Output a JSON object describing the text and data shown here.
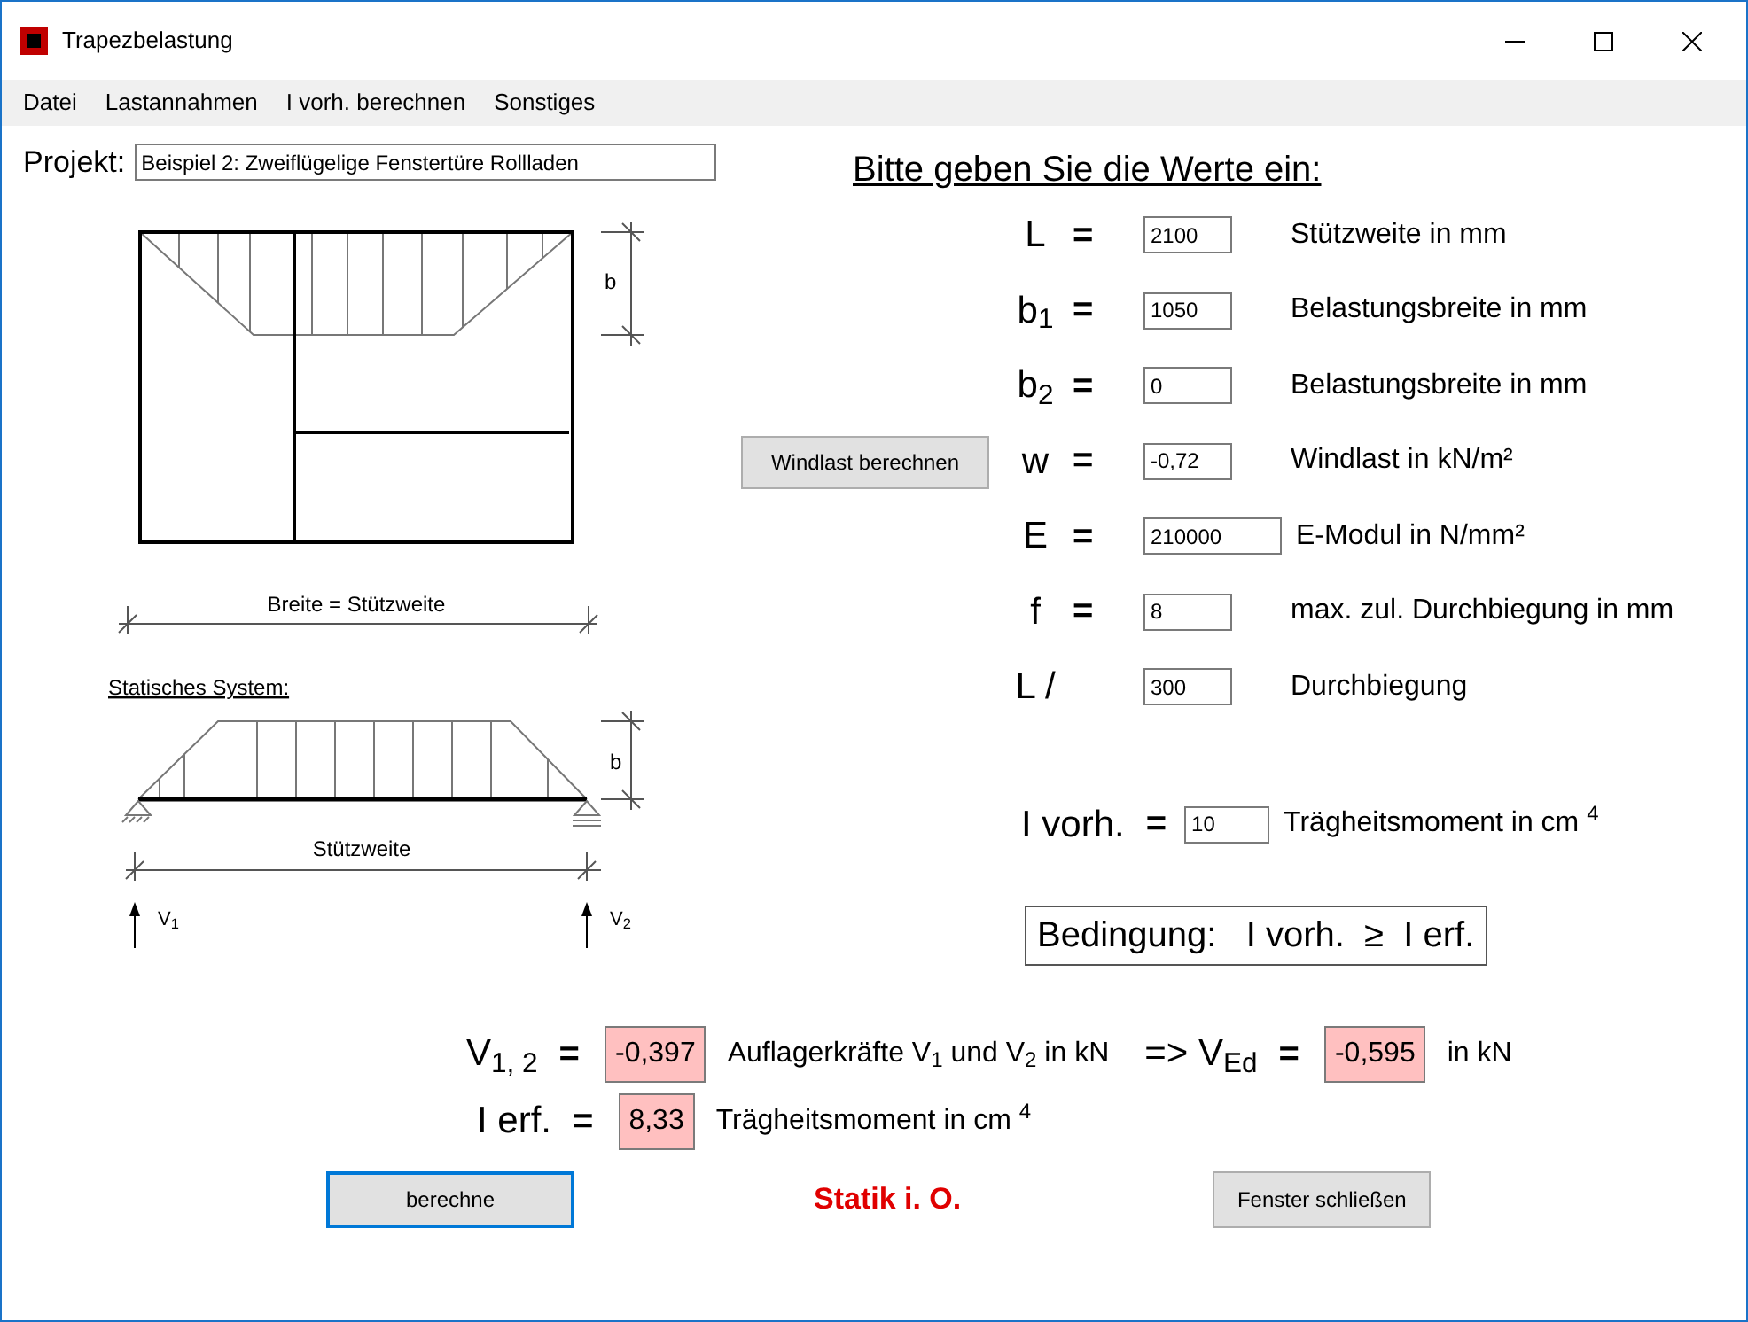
{
  "window": {
    "title": "Trapezbelastung"
  },
  "menu": [
    "Datei",
    "Lastannahmen",
    "I vorh. berechnen",
    "Sonstiges"
  ],
  "project": {
    "label": "Projekt:",
    "value": "Beispiel 2: Zweiflügelige Fenstertüre Rollladen"
  },
  "window_diagram": {
    "b_label": "b",
    "width_label": "Breite = Stützweite"
  },
  "static_system": {
    "title": "Statisches System:",
    "b_label": "b",
    "span_label": "Stützweite",
    "support_labels": [
      "V$_{1}$",
      "V$_{2}$"
    ]
  },
  "input_heading": "Bitte geben Sie die Werte ein:",
  "inputs": [
    {
      "symbol": "L",
      "equals": "=",
      "value": "2100",
      "unit": "Stützweite in mm",
      "kind": "narrow"
    },
    {
      "symbol": "b$_{1}$",
      "equals": "=",
      "value": "1050",
      "unit": "Belastungsbreite in mm",
      "kind": "narrow"
    },
    {
      "symbol": "b$_{2}$",
      "equals": "=",
      "value": "0",
      "unit": "Belastungsbreite in mm",
      "kind": "narrow"
    },
    {
      "symbol": "w",
      "equals": "=",
      "value": "-0,72",
      "unit": "Windlast in kN/m²",
      "kind": "narrow",
      "action_button": "Windlast berechnen"
    },
    {
      "symbol": "E",
      "equals": "=",
      "value": "210000",
      "unit": "E-Modul in N/mm²",
      "kind": "wide"
    },
    {
      "symbol": "f",
      "equals": "=",
      "value": "8",
      "unit": "max. zul. Durchbiegung in mm",
      "kind": "narrow"
    },
    {
      "symbol": "L /",
      "value": "300",
      "unit": "Durchbiegung",
      "kind": "narrow"
    }
  ],
  "i_vorh": {
    "symbol": "I vorh.",
    "equals": "=",
    "value": "10",
    "unit": "Trägheitsmoment in cm $^{4}$"
  },
  "condition": "Bedingung:   I vorh.  ≥  I erf.",
  "support_forces": {
    "symbol": "V$_{1, 2}$",
    "equals": "=",
    "value": "-0,397",
    "unit": "Auflagerkräfte V$_{1}$ und V$_{2}$ in kN"
  },
  "design_force": {
    "symbol": "=> V$_{Ed}$",
    "equals": "=",
    "value": "-0,595",
    "unit": "in kN"
  },
  "i_erf": {
    "symbol": "I erf.",
    "equals": "=",
    "value": "8,33",
    "unit": "Trägheitsmoment in cm $^{4}$"
  },
  "calculate_button": {
    "label": "berechne",
    "focused": true
  },
  "status": "Statik i. O.",
  "close_button": "Fenster schließen"
}
